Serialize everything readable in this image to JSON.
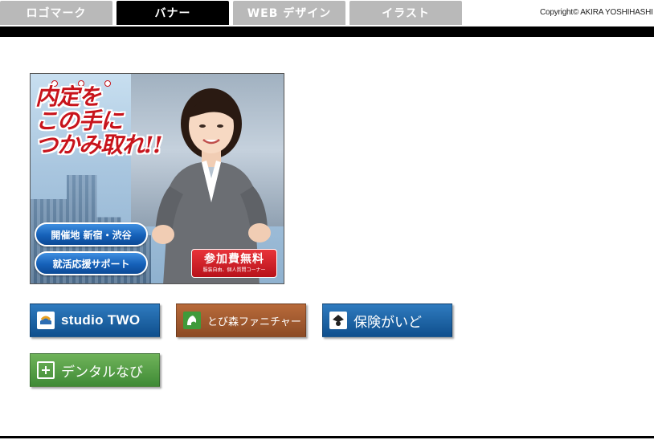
{
  "nav": {
    "tabs": [
      {
        "label": "ロゴマーク",
        "active": false
      },
      {
        "label": "バナー",
        "active": true
      },
      {
        "label": "WEB デザイン",
        "active": false
      },
      {
        "label": "イラスト",
        "active": false
      }
    ],
    "copyright": "Copyright© AKIRA YOSHIHASHI"
  },
  "main_banner": {
    "headline": "内定を\nこの手に\nつかみ取れ!!",
    "venue": "開催地 新宿・渋谷",
    "support": "就活応援サポート",
    "fee": "参加費無料",
    "fee_note": "服装自由、個人質問コーナー"
  },
  "banners": [
    {
      "label": "studio TWO",
      "icon": "studio-two-logo-icon"
    },
    {
      "label": "とび森ファニチャー",
      "icon": "leaf-animal-icon"
    },
    {
      "label": "保険がいど",
      "icon": "shield-figure-icon"
    },
    {
      "label": "デンタルなび",
      "icon": "dental-plus-icon"
    }
  ],
  "colors": {
    "tab_inactive": "#b9b9b9",
    "tab_active": "#000000",
    "headline_red": "#c8141c",
    "blue_banner": "#1a5fa0",
    "brown_banner": "#9e5a2f",
    "green_banner": "#56a046"
  }
}
